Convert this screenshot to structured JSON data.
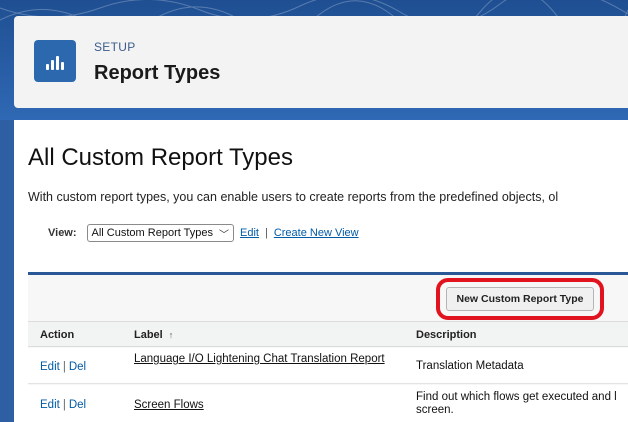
{
  "header": {
    "eyebrow": "SETUP",
    "title": "Report Types",
    "icon": "report-chart-icon"
  },
  "main": {
    "heading": "All Custom Report Types",
    "intro": "With custom report types, you can enable users to create reports from the predefined objects, ol",
    "view": {
      "label": "View:",
      "selected": "All Custom Report Types",
      "edit_link": "Edit",
      "separator": "|",
      "create_link": "Create New View"
    },
    "new_button": "New Custom Report Type",
    "highlight_color": "#e0131f",
    "table": {
      "headers": {
        "action": "Action",
        "label": "Label",
        "label_sort": "↑",
        "description": "Description"
      },
      "rows": [
        {
          "edit": "Edit",
          "sep": "|",
          "del": "Del",
          "label": "Language I/O Lightening Chat Translation Report",
          "description": "Translation Metadata"
        },
        {
          "edit": "Edit",
          "sep": "|",
          "del": "Del",
          "label": "Screen Flows",
          "description": "Find out which flows get executed and l screen."
        }
      ]
    }
  }
}
